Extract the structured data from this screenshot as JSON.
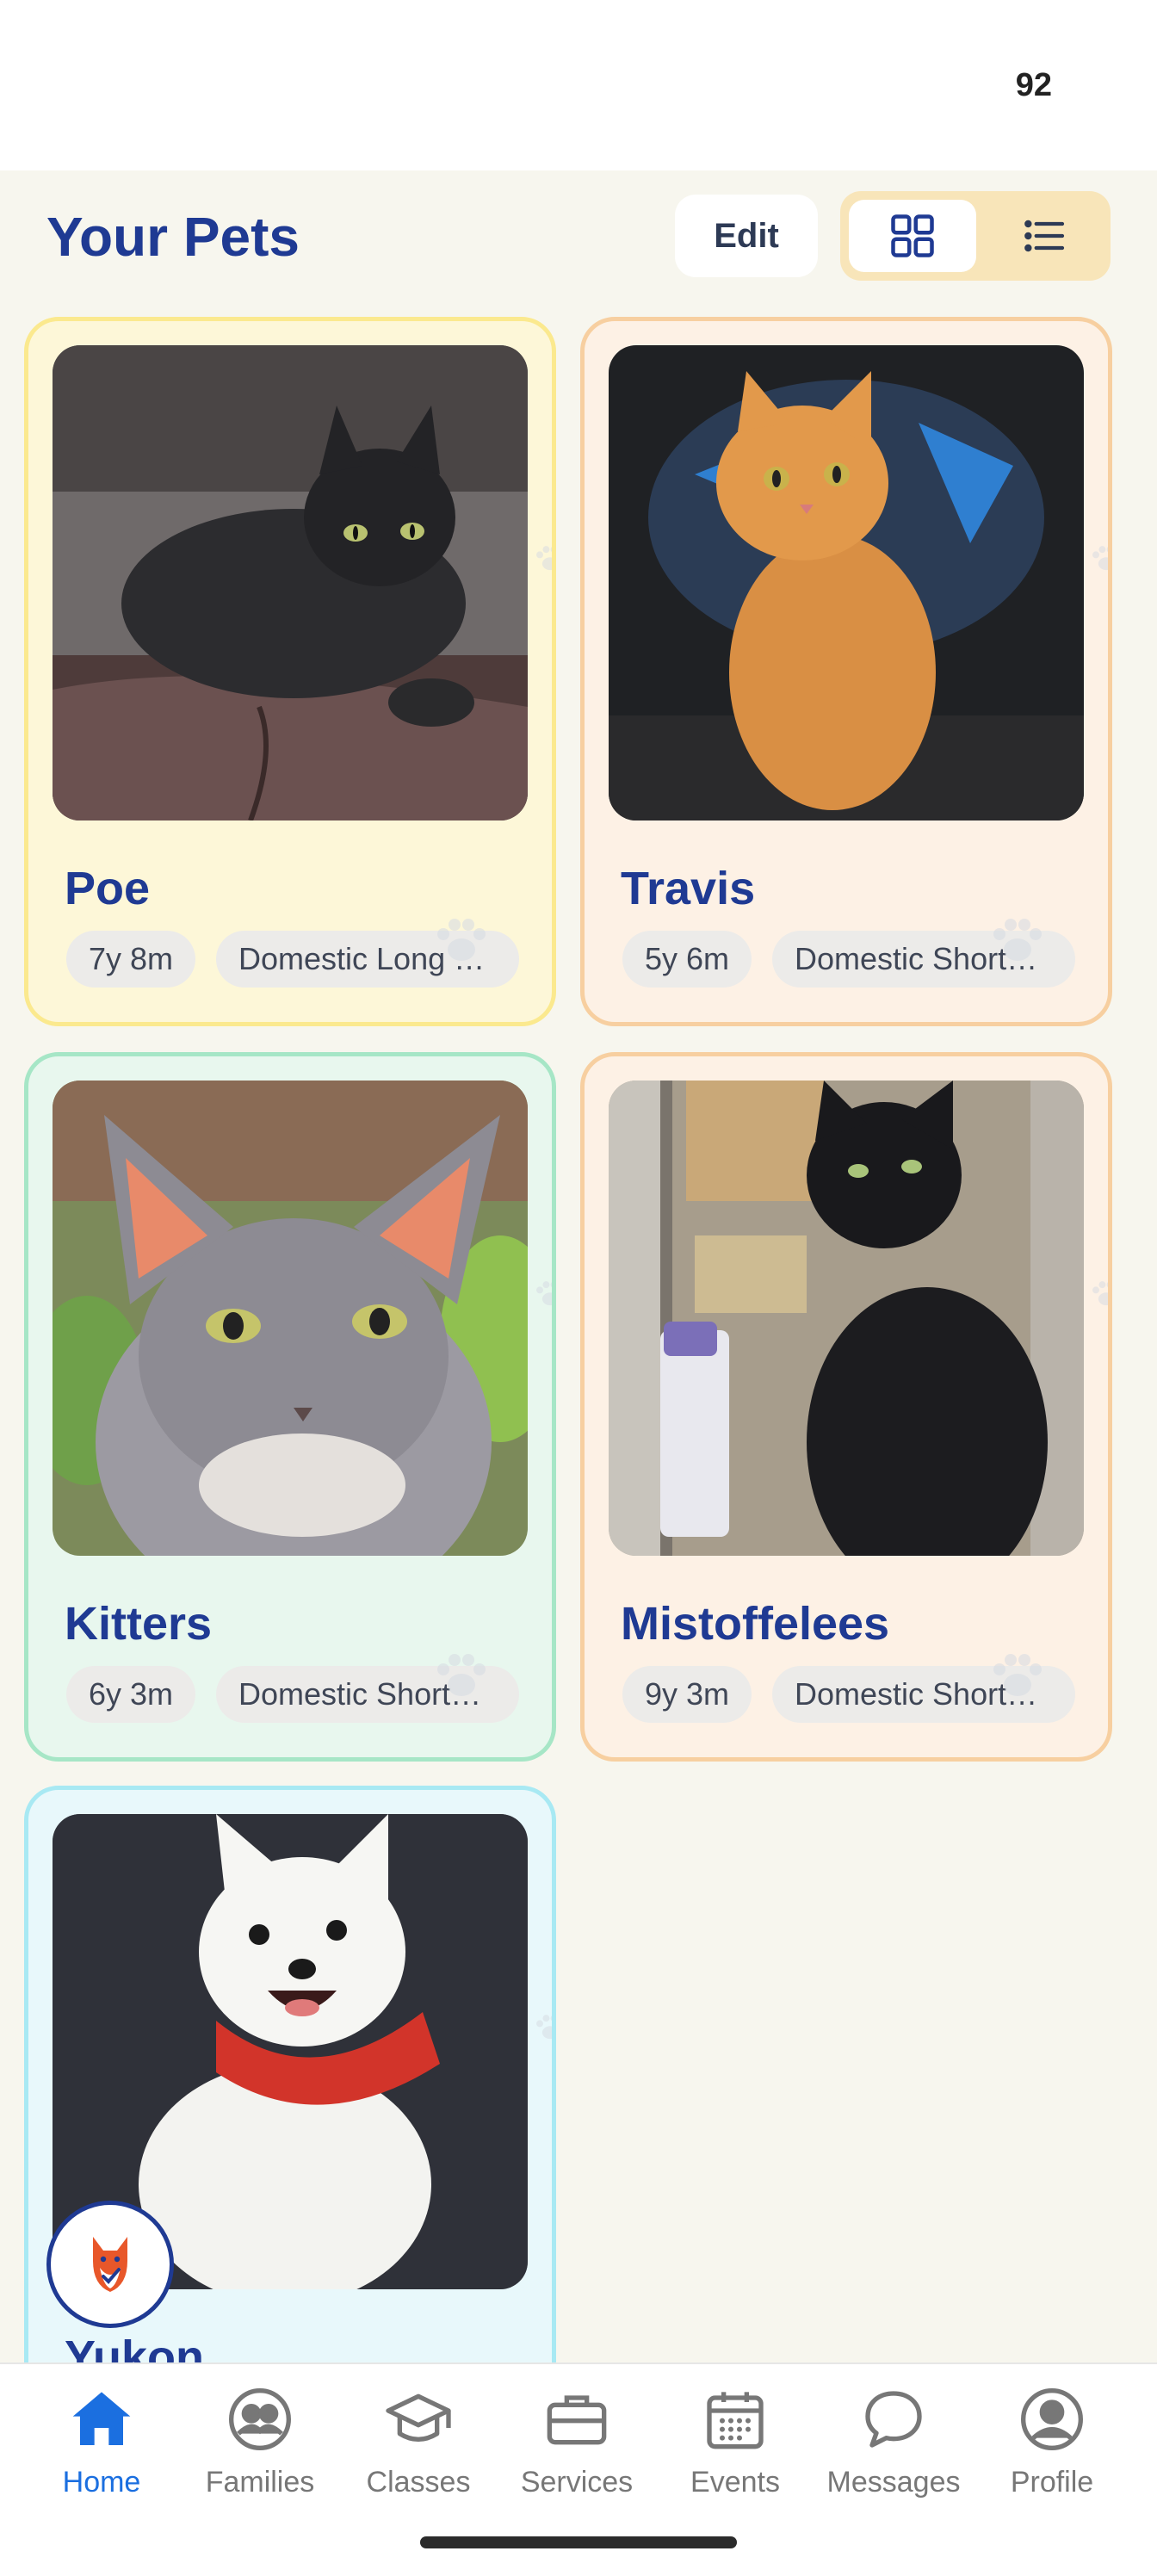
{
  "status_bar": {
    "battery": "92"
  },
  "header": {
    "title": "Your Pets",
    "edit_label": "Edit",
    "view_mode": "grid"
  },
  "pets": [
    {
      "name": "Poe",
      "age": "7y 8m",
      "breed": "Domestic Long …",
      "border_color": "#fbe98e",
      "bg_color": "#fdf7d8"
    },
    {
      "name": "Travis",
      "age": "5y 6m",
      "breed": "Domestic Short…",
      "border_color": "#f7cfa0",
      "bg_color": "#fdf1e5"
    },
    {
      "name": "Kitters",
      "age": "6y 3m",
      "breed": "Domestic Short…",
      "border_color": "#a6e6c6",
      "bg_color": "#e8f7ee"
    },
    {
      "name": "Mistoffelees",
      "age": "9y 3m",
      "breed": "Domestic Short…",
      "border_color": "#f7cfa0",
      "bg_color": "#fdf1e5"
    },
    {
      "name": "Yukon",
      "border_color": "#a8e9f3",
      "bg_color": "#e8f8fb"
    }
  ],
  "nav": [
    {
      "label": "Home",
      "icon": "home-icon",
      "active": true
    },
    {
      "label": "Families",
      "icon": "families-icon",
      "active": false
    },
    {
      "label": "Classes",
      "icon": "classes-icon",
      "active": false
    },
    {
      "label": "Services",
      "icon": "services-icon",
      "active": false
    },
    {
      "label": "Events",
      "icon": "events-icon",
      "active": false
    },
    {
      "label": "Messages",
      "icon": "messages-icon",
      "active": false
    },
    {
      "label": "Profile",
      "icon": "profile-icon",
      "active": false
    }
  ],
  "colors": {
    "accent": "#1f3a93",
    "nav_active": "#1b6fe0",
    "background": "#f7f6ee"
  }
}
